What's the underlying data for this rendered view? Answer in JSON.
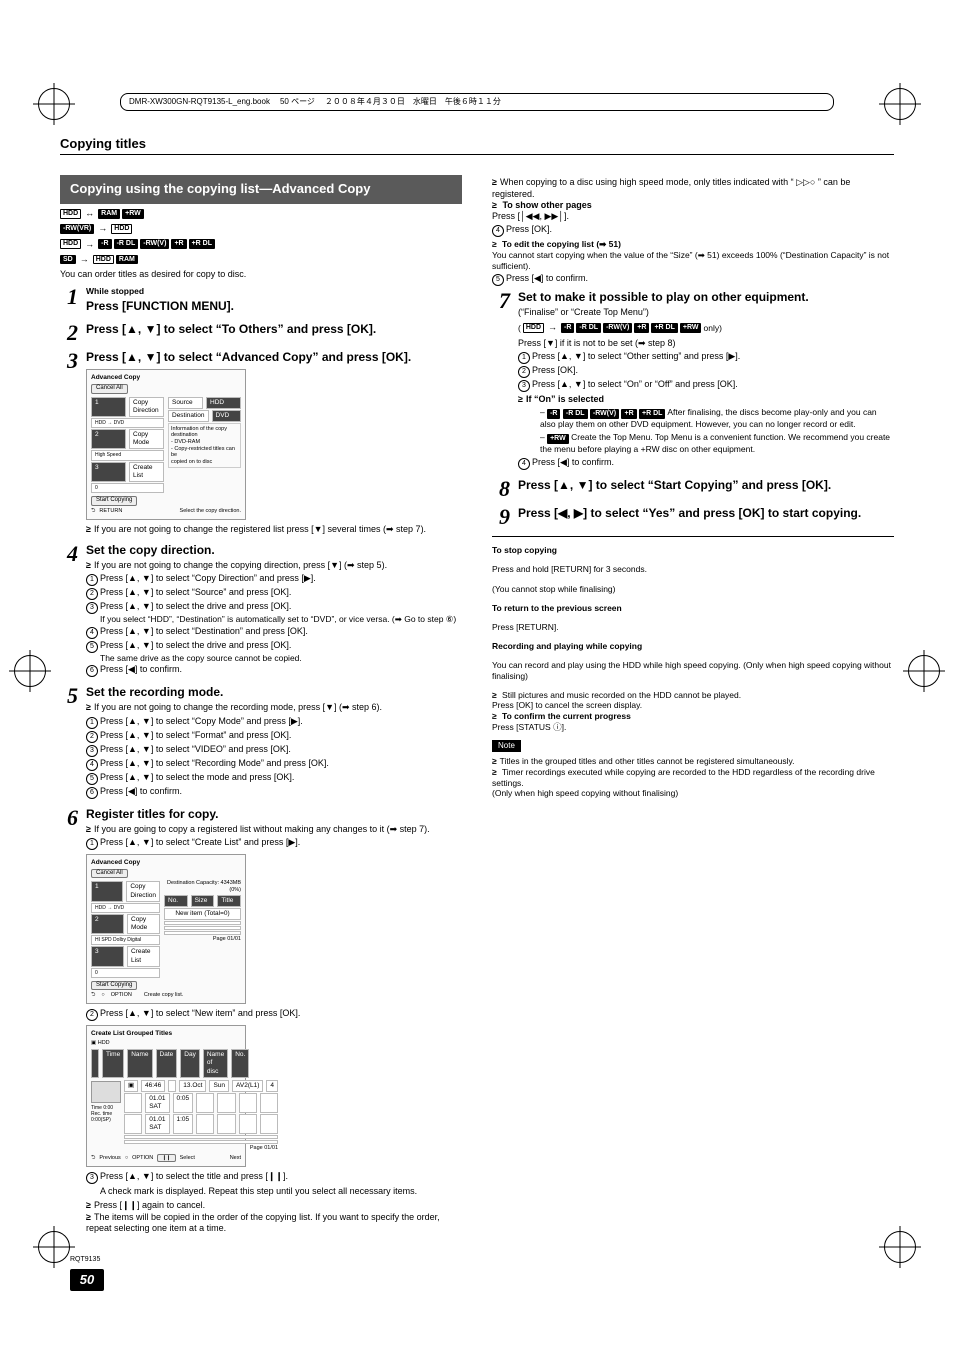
{
  "spine": {
    "filename": "DMR-XW300GN-RQT9135-L_eng.book",
    "page": "50 ページ",
    "date": "２００８年４月３０日　水曜日　午後６時１１分"
  },
  "header": "Copying titles",
  "titleBar": "Copying using the copying list—Advanced Copy",
  "mediaRows": [
    {
      "items": [
        "HDD",
        "↔",
        "RAM",
        "+RW"
      ],
      "types": [
        "outline",
        "arrow",
        "badge",
        "badge"
      ]
    },
    {
      "items": [
        "-RW(VR)",
        "→",
        "HDD"
      ],
      "types": [
        "badge",
        "arrow",
        "outline"
      ]
    },
    {
      "items": [
        "HDD",
        "→",
        "-R",
        "-R DL",
        "-RW(V)",
        "+R",
        "+R DL"
      ],
      "types": [
        "outline",
        "arrow",
        "badge",
        "badge",
        "badge",
        "badge",
        "badge"
      ]
    },
    {
      "items": [
        "SD",
        "→",
        "HDD",
        "RAM"
      ],
      "types": [
        "badge",
        "arrow",
        "outline",
        "badge"
      ]
    }
  ],
  "intro": "You can order titles as desired for copy to disc.",
  "steps": {
    "s1": {
      "pre": "While stopped",
      "title": "Press [FUNCTION MENU]."
    },
    "s2": {
      "title": "Press [▲, ▼] to select “To Others” and press [OK]."
    },
    "s3": {
      "title": "Press [▲, ▼] to select “Advanced Copy” and press [OK].",
      "after": "If you are not going to change the registered list press [▼] several times (➡ step 7).",
      "shot": {
        "hdr": "Advanced Copy",
        "cancel": "Cancel All",
        "rows": [
          {
            "n": "1",
            "label": "Copy Direction",
            "sub": "HDD → DVD"
          },
          {
            "n": "2",
            "label": "Copy Mode",
            "sub": "High Speed"
          },
          {
            "n": "3",
            "label": "Create List",
            "sub": "0"
          }
        ],
        "right1": "Source",
        "right1v": "HDD",
        "right2": "Destination",
        "right2v": "DVD",
        "info": [
          "Information of the copy destination",
          "- DVD-RAM",
          "- Copy-restricted titles can be",
          "  copied on to disc"
        ],
        "start": "Start Copying",
        "foot": "Select the copy direction.",
        "footIcon": "RETURN"
      }
    },
    "s4": {
      "title": "Set the copy direction.",
      "lead": "If you are not going to change the copying direction, press [▼] (➡ step 5).",
      "items": [
        "Press [▲, ▼] to select “Copy Direction” and press [▶].",
        "Press [▲, ▼] to select “Source” and press [OK].",
        "Press [▲, ▼] to select the drive and press [OK].",
        "Press [▲, ▼] to select “Destination” and press [OK].",
        "Press [▲, ▼] to select the drive and press [OK].",
        "Press [◀] to confirm."
      ],
      "sub3": "If you select “HDD”, “Destination” is automatically set to “DVD”, or vice versa. (➡ Go to step ⑥)",
      "sub5": "The same drive as the copy source cannot be copied."
    },
    "s5": {
      "title": "Set the recording mode.",
      "lead": "If you are not going to change the recording mode, press [▼] (➡ step 6).",
      "items": [
        "Press [▲, ▼] to select “Copy Mode” and press [▶].",
        "Press [▲, ▼] to select “Format” and press [OK].",
        "Press [▲, ▼] to select “VIDEO” and press [OK].",
        "Press [▲, ▼] to select “Recording Mode” and press [OK].",
        "Press [▲, ▼] to select the mode and press [OK].",
        "Press [◀] to confirm."
      ]
    },
    "s6": {
      "title": "Register titles for copy.",
      "lead": "If you are going to copy a registered list without making any changes to it (➡ step 7).",
      "item1": "Press [▲, ▼] to select “Create List” and press [▶].",
      "shotA": {
        "hdr": "Advanced Copy",
        "cancel": "Cancel All",
        "rows": [
          {
            "n": "1",
            "label": "Copy Direction",
            "sub": "HDD → DVD"
          },
          {
            "n": "2",
            "label": "Copy Mode",
            "sub": "HI SPD Dolby Digital"
          },
          {
            "n": "3",
            "label": "Create List",
            "sub": "0"
          }
        ],
        "rightHdr": "Destination Capacity:  4343MB",
        "rightPct": "(0%)",
        "cols": [
          "No.",
          "Size",
          "Title"
        ],
        "newItem": "New item (Total=0)",
        "page": "Page 01/01",
        "start": "Start Copying",
        "foot": "Create copy list.",
        "opt": "OPTION"
      },
      "item2": "Press [▲, ▼] to select “New item” and press [OK].",
      "shotB": {
        "hdr": "Create List  Grouped Titles",
        "media": "HDD",
        "cols": [
          "",
          "Time",
          "Name",
          "Date",
          "Day",
          "Name of disc",
          "No."
        ],
        "r1": [
          "",
          "46:46",
          "",
          "13.Oct",
          "Sun",
          "AV2(L1)",
          "4"
        ],
        "r2": [
          "",
          "01.01 SAT",
          "0:05",
          "",
          "",
          "",
          ""
        ],
        "r3": [
          "",
          "01.01 SAT",
          "1:05",
          "",
          "",
          "",
          ""
        ],
        "timeLabel": "Time",
        "timeVal": "0:00",
        "remLabel": "Rec. time 0:00(SP)",
        "page": "Page 01/01",
        "prev": "Previous",
        "next": "Next",
        "opt": "OPTION",
        "sel": "Select"
      },
      "item3": "Press [▲, ▼] to select the title and press [❙❙].",
      "post": [
        "A check mark is displayed. Repeat this step until you select all necessary items.",
        "Press [❙❙] again to cancel.",
        "The items will be copied in the order of the copying list. If you want to specify the order, repeat selecting one item at a time."
      ]
    }
  },
  "right": {
    "topBullets": [
      "When copying to a disc using high speed mode, only titles indicated with “ ▷▷○ ” can be registered."
    ],
    "showOther": {
      "label": "To show other pages",
      "text": "Press [│◀◀, ▶▶│]."
    },
    "four": "Press [OK].",
    "editNote": {
      "label": "To edit the copying list (➡ 51)",
      "text": "You cannot start copying when the value of the “Size” (➡ 51) exceeds 100% (“Destination Capacity” is not sufficient)."
    },
    "five": "Press [◀] to confirm.",
    "s7": {
      "title": "Set to make it possible to play on other equipment.",
      "sub": "(“Finalise” or “Create Top Menu”)",
      "badges": [
        "HDD",
        "→",
        "-R",
        "-R DL",
        "-RW(V)",
        "+R",
        "+R DL",
        "+RW"
      ],
      "badgeTypes": [
        "outline",
        "arrow",
        "badge",
        "badge",
        "badge",
        "badge",
        "badge",
        "badge"
      ],
      "only": " only)",
      "preline": "Press [▼] if it is not to be set (➡ step 8)",
      "items": [
        "Press [▲, ▼] to select “Other setting” and press [▶].",
        "Press [OK].",
        "Press [▲, ▼] to select “On” or “Off” and press [OK]."
      ],
      "ifOn": "If “On” is selected",
      "onA_badges": [
        "-R",
        "-R DL",
        "-RW(V)",
        "+R",
        "+R DL"
      ],
      "onA": " After finalising, the discs become play-only and you can also play them on other DVD equipment. However, you can no longer record or edit.",
      "onB_badge": "+RW",
      "onB": " Create the Top Menu. Top Menu is a convenient function. We recommend you create the menu before playing a +RW disc on other equipment.",
      "four": "Press [◀] to confirm."
    },
    "s8": {
      "title": "Press [▲, ▼] to select “Start Copying” and press [OK]."
    },
    "s9": {
      "title": "Press [◀, ▶] to select “Yes” and press [OK] to start copying."
    },
    "stop": {
      "h": "To stop copying",
      "t1": "Press and hold [RETURN] for 3 seconds.",
      "t2": "(You cannot stop while finalising)"
    },
    "return": {
      "h": "To return to the previous screen",
      "t": "Press [RETURN]."
    },
    "rec": {
      "h": "Recording and playing while copying",
      "t1": "You can record and play using the HDD while high speed copying. (Only when high speed copying without finalising)",
      "b1": "Still pictures and music recorded on the HDD cannot be played.",
      "b1s": "Press [OK] to cancel the screen display.",
      "b2": "To confirm the current progress",
      "b2s": "Press [STATUS ⓘ]."
    },
    "note": {
      "label": "Note",
      "b1": "Titles in the grouped titles and other titles cannot be registered simultaneously.",
      "b2": "Timer recordings executed while copying are recorded to the HDD regardless of the recording drive settings.",
      "b2s": "(Only when high speed copying without finalising)"
    }
  },
  "footer": {
    "rqt": "RQT9135",
    "page": "50"
  }
}
